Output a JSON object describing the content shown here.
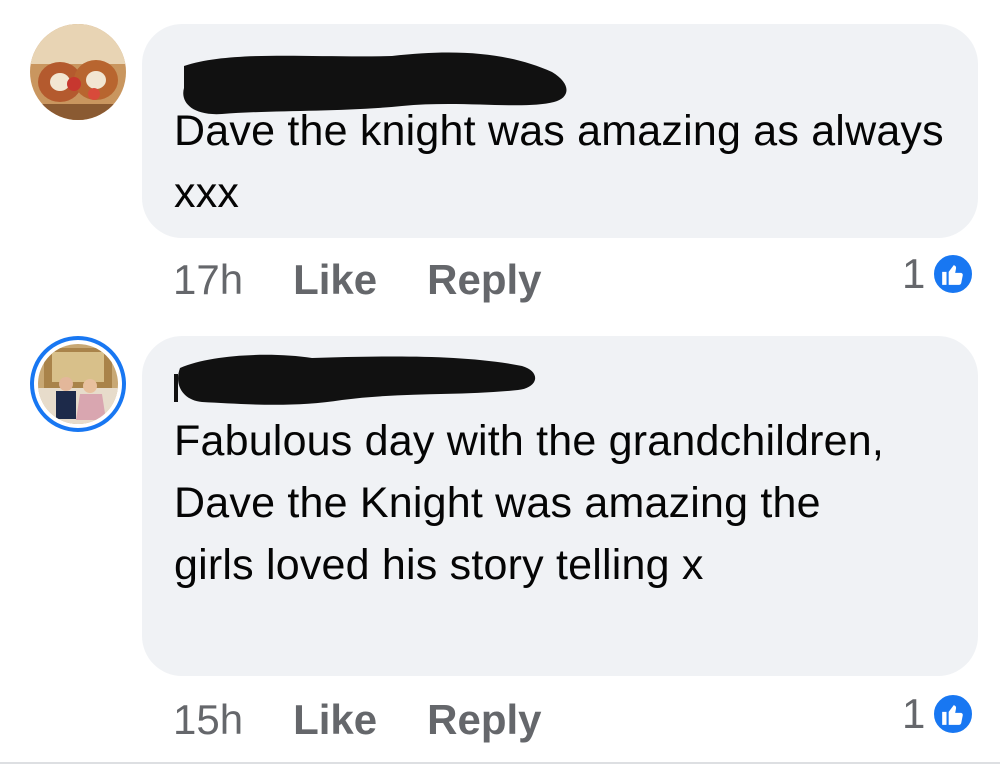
{
  "comments": [
    {
      "text": "Dave the knight was amazing as always xxx",
      "time": "17h",
      "like_label": "Like",
      "reply_label": "Reply",
      "reaction_count": "1",
      "avatar_icon": "user-avatar-icon"
    },
    {
      "text": "Fabulous day with the grandchildren, Dave the Knight was amazing the girls loved his story telling x",
      "time": "15h",
      "like_label": "Like",
      "reply_label": "Reply",
      "reaction_count": "1",
      "avatar_icon": "user-avatar-icon"
    }
  ],
  "colors": {
    "bubble": "#f0f2f5",
    "meta_text": "#65676b",
    "like_blue": "#1877f2",
    "story_ring": "#1877f2"
  }
}
